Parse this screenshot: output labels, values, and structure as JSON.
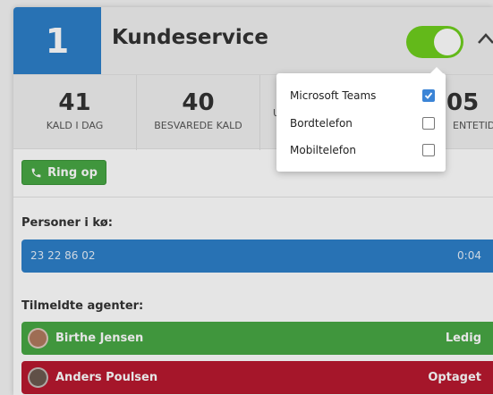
{
  "queue": {
    "number": "1",
    "title": "Kundeservice",
    "enabled": true
  },
  "stats": [
    {
      "value": "41",
      "label": "KALD I DAG"
    },
    {
      "value": "40",
      "label": "BESVAREDE KALD"
    },
    {
      "value": "",
      "label": "U"
    },
    {
      "value": "05",
      "label": "ENTETID"
    }
  ],
  "actions": {
    "call_label": "Ring op"
  },
  "queue_list": {
    "label": "Personer i kø:",
    "callers": [
      {
        "number": "23 22 86 02",
        "wait": "0:04"
      }
    ]
  },
  "agents": {
    "label": "Tilmeldte agenter:",
    "items": [
      {
        "name": "Birthe Jensen",
        "status": "Ledig",
        "color": "#48a844"
      },
      {
        "name": "Anders Poulsen",
        "status": "Optaget",
        "color": "#b8192f"
      }
    ]
  },
  "device_menu": {
    "options": [
      {
        "label": "Microsoft Teams",
        "checked": true
      },
      {
        "label": "Bordtelefon",
        "checked": false
      },
      {
        "label": "Mobiltelefon",
        "checked": false
      }
    ]
  },
  "colors": {
    "primary": "#2d7fc9",
    "toggle_on": "#6fce1e",
    "available": "#48a844",
    "busy": "#b8192f"
  },
  "icons": {
    "call": "phone-icon",
    "collapse": "chevron-up-icon",
    "checkbox": "check-icon"
  }
}
